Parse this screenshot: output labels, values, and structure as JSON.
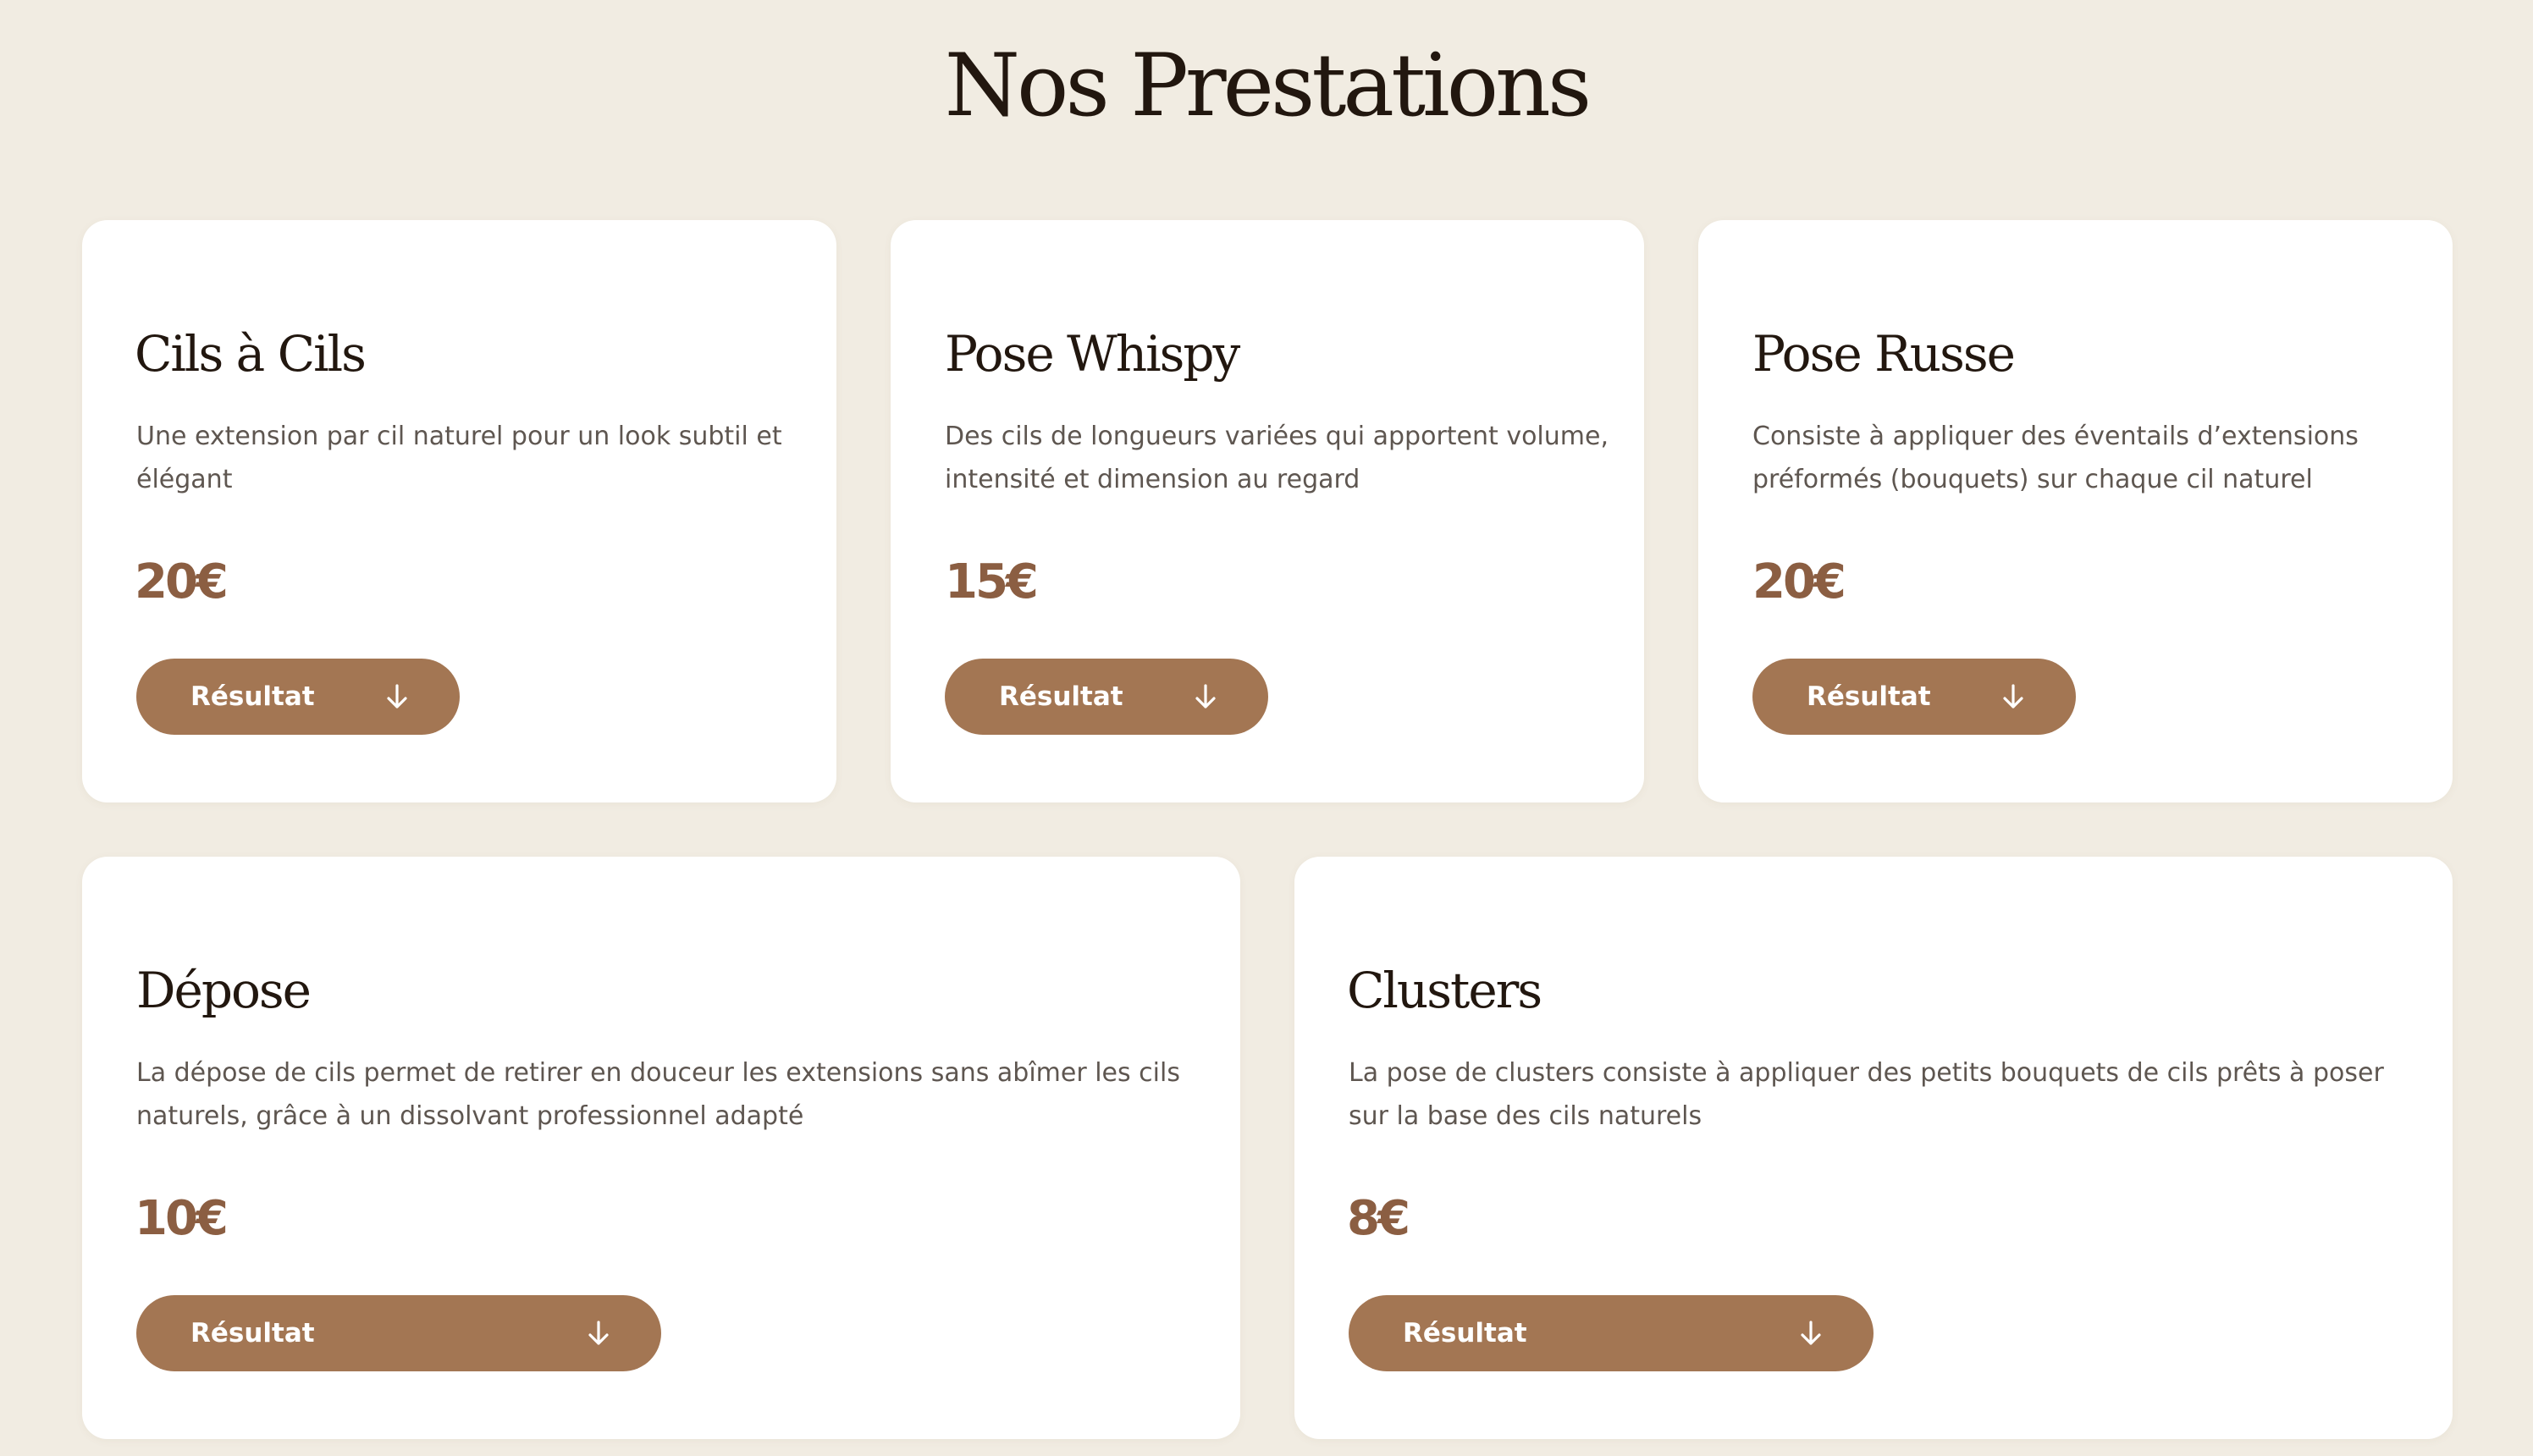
{
  "page": {
    "title": "Nos Prestations"
  },
  "colors": {
    "background": "#f1ece2",
    "card": "#ffffff",
    "accent": "#a37653",
    "price": "#8b5e42",
    "title_text": "#22170f",
    "body_text": "#5e5650"
  },
  "services": [
    {
      "title": "Cils à Cils",
      "description_line1": "Une extension par cil naturel pour un look subtil et",
      "description_line2": "élégant",
      "price": "20€",
      "button_label": "Résultat",
      "button_icon": "arrow-down-icon"
    },
    {
      "title": "Pose Whispy",
      "description_line1": "Des cils de longueurs variées qui apportent volume,",
      "description_line2": "intensité et dimension au regard",
      "price": "15€",
      "button_label": "Résultat",
      "button_icon": "arrow-down-icon"
    },
    {
      "title": "Pose Russe",
      "description_line1": "Consiste à appliquer des éventails d’extensions",
      "description_line2": "préformés (bouquets) sur chaque cil naturel",
      "price": "20€",
      "button_label": "Résultat",
      "button_icon": "arrow-down-icon"
    },
    {
      "title": "Dépose",
      "description_line1": "La dépose de cils permet de retirer en douceur les extensions sans abîmer les cils",
      "description_line2": "naturels, grâce à un dissolvant professionnel adapté",
      "price": "10€",
      "button_label": "Résultat",
      "button_icon": "arrow-down-icon"
    },
    {
      "title": "Clusters",
      "description_line1": "La pose de clusters consiste à appliquer des petits bouquets de cils prêts à poser",
      "description_line2": "sur la base des cils naturels",
      "price": "8€",
      "button_label": "Résultat",
      "button_icon": "arrow-down-icon"
    }
  ]
}
